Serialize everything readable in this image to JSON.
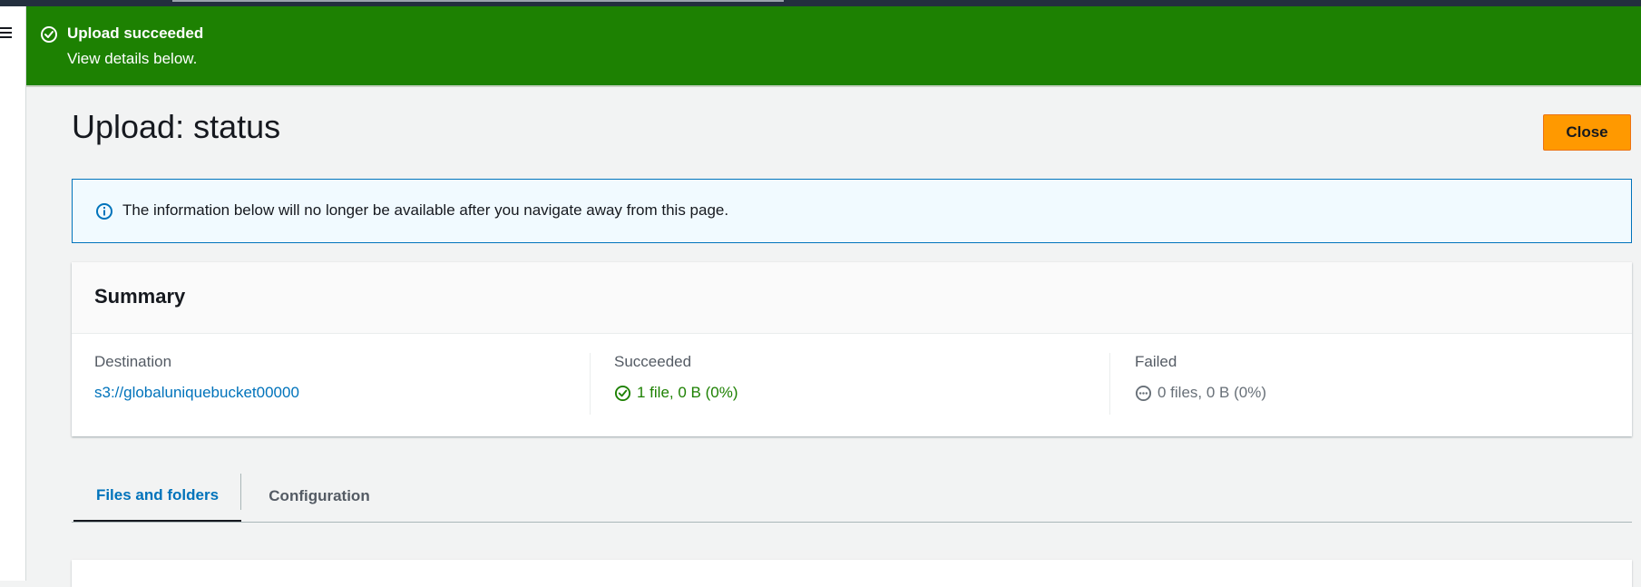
{
  "flash": {
    "title": "Upload succeeded",
    "text": "View details below.",
    "icon": "check-circle-icon",
    "color": "#1d8102"
  },
  "header": {
    "title": "Upload: status",
    "close_label": "Close",
    "close_color": "#ff9900"
  },
  "info": {
    "icon": "info-icon",
    "text": "The information below will no longer be available after you navigate away from this page."
  },
  "summary": {
    "title": "Summary",
    "destination": {
      "label": "Destination",
      "value": "s3://globaluniquebucket00000"
    },
    "succeeded": {
      "label": "Succeeded",
      "icon": "check-circle-icon",
      "value": "1 file, 0 B (0%)"
    },
    "failed": {
      "label": "Failed",
      "icon": "ellipsis-circle-icon",
      "value": "0 files, 0 B (0%)"
    }
  },
  "tabs": [
    {
      "label": "Files and folders",
      "active": true
    },
    {
      "label": "Configuration",
      "active": false
    }
  ],
  "nav": {
    "menu_icon": "hamburger-menu-icon"
  }
}
